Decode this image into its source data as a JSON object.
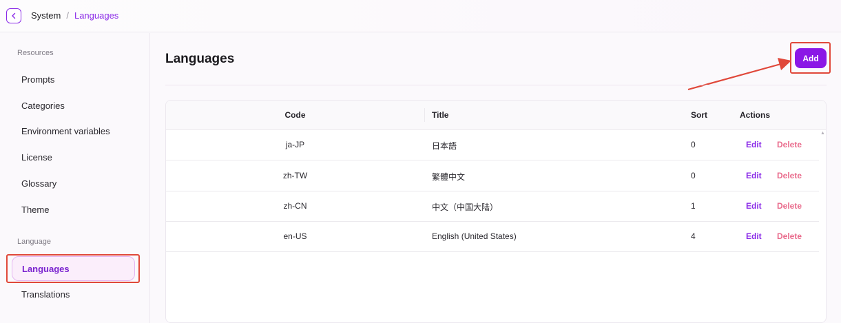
{
  "breadcrumb": {
    "parent": "System",
    "separator": "/",
    "current": "Languages"
  },
  "sidebar": {
    "section_resources": "Resources",
    "resources_items": [
      "Prompts",
      "Categories",
      "Environment variables",
      "License",
      "Glossary",
      "Theme"
    ],
    "section_language": "Language",
    "language_items": [
      "Languages",
      "Translations"
    ],
    "active_item": "Languages"
  },
  "main": {
    "title": "Languages",
    "add_label": "Add"
  },
  "table": {
    "columns": [
      "Code",
      "Title",
      "Sort",
      "Actions"
    ],
    "rows": [
      {
        "code": "ja-JP",
        "title": "日本語",
        "sort": "0"
      },
      {
        "code": "zh-TW",
        "title": "繁體中文",
        "sort": "0"
      },
      {
        "code": "zh-CN",
        "title": "中文（中国大陆）",
        "sort": "1"
      },
      {
        "code": "en-US",
        "title": "English (United States)",
        "sort": "4"
      }
    ],
    "edit_label": "Edit",
    "delete_label": "Delete"
  },
  "colors": {
    "accent": "#8b17e6",
    "annotation": "#e0483a",
    "delete": "#e96b8c"
  },
  "icons": {
    "back": "chevron-left-icon",
    "scroll": "scroll-up-arrow-icon"
  }
}
